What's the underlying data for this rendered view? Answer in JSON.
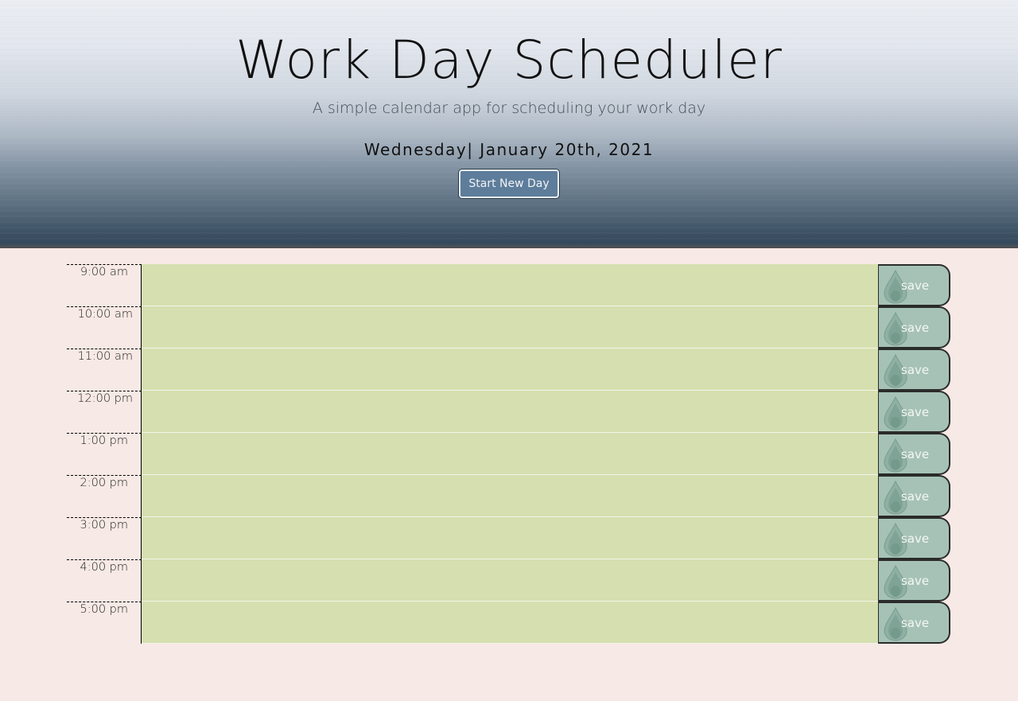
{
  "header": {
    "title": "Work Day Scheduler",
    "subtitle": "A simple calendar app for scheduling your work day",
    "current_day": "Wednesday| January 20th, 2021",
    "new_day_button": "Start New Day"
  },
  "colors": {
    "task_row": "#d6dfb0",
    "save_button": "#a6c2b6",
    "page_background": "#f7e9e5",
    "new_day_button": "#5e7d9b"
  },
  "time_blocks": [
    {
      "hour": "9:00 am",
      "task": "",
      "save_label": "save",
      "icon": "drop-icon"
    },
    {
      "hour": "10:00 am",
      "task": "",
      "save_label": "save",
      "icon": "drop-icon"
    },
    {
      "hour": "11:00 am",
      "task": "",
      "save_label": "save",
      "icon": "drop-icon"
    },
    {
      "hour": "12:00 pm",
      "task": "",
      "save_label": "save",
      "icon": "drop-icon"
    },
    {
      "hour": "1:00 pm",
      "task": "",
      "save_label": "save",
      "icon": "drop-icon"
    },
    {
      "hour": "2:00 pm",
      "task": "",
      "save_label": "save",
      "icon": "drop-icon"
    },
    {
      "hour": "3:00 pm",
      "task": "",
      "save_label": "save",
      "icon": "drop-icon"
    },
    {
      "hour": "4:00 pm",
      "task": "",
      "save_label": "save",
      "icon": "drop-icon"
    },
    {
      "hour": "5:00 pm",
      "task": "",
      "save_label": "save",
      "icon": "drop-icon"
    }
  ]
}
